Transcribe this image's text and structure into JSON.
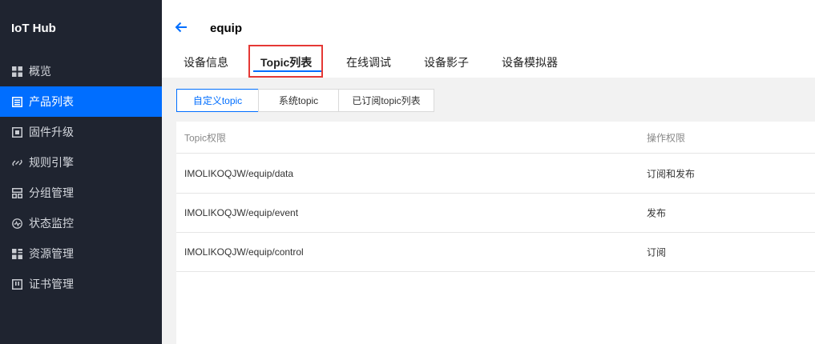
{
  "sidebar": {
    "title": "IoT Hub",
    "items": [
      {
        "label": "概览",
        "icon": "grid-icon"
      },
      {
        "label": "产品列表",
        "icon": "list-icon"
      },
      {
        "label": "固件升级",
        "icon": "upgrade-icon"
      },
      {
        "label": "规则引擎",
        "icon": "link-icon"
      },
      {
        "label": "分组管理",
        "icon": "group-icon"
      },
      {
        "label": "状态监控",
        "icon": "monitor-icon"
      },
      {
        "label": "资源管理",
        "icon": "resource-icon"
      },
      {
        "label": "证书管理",
        "icon": "certificate-icon"
      }
    ],
    "active_index": 1
  },
  "header": {
    "title": "equip",
    "back_icon": "arrow-left-icon",
    "tabs": [
      {
        "label": "设备信息"
      },
      {
        "label": "Topic列表"
      },
      {
        "label": "在线调试"
      },
      {
        "label": "设备影子"
      },
      {
        "label": "设备模拟器"
      }
    ],
    "active_tab": 1
  },
  "subtabs": [
    {
      "label": "自定义topic"
    },
    {
      "label": "系统topic"
    },
    {
      "label": "已订阅topic列表"
    }
  ],
  "table": {
    "columns": [
      "Topic权限",
      "操作权限"
    ],
    "rows": [
      [
        "IMOLIKOQJW/equip/data",
        "订阅和发布"
      ],
      [
        "IMOLIKOQJW/equip/event",
        "发布"
      ],
      [
        "IMOLIKOQJW/equip/control",
        "订阅"
      ]
    ]
  },
  "colors": {
    "accent": "#006eff",
    "sidebar_bg": "#1f2430",
    "highlight": "#e53935"
  }
}
